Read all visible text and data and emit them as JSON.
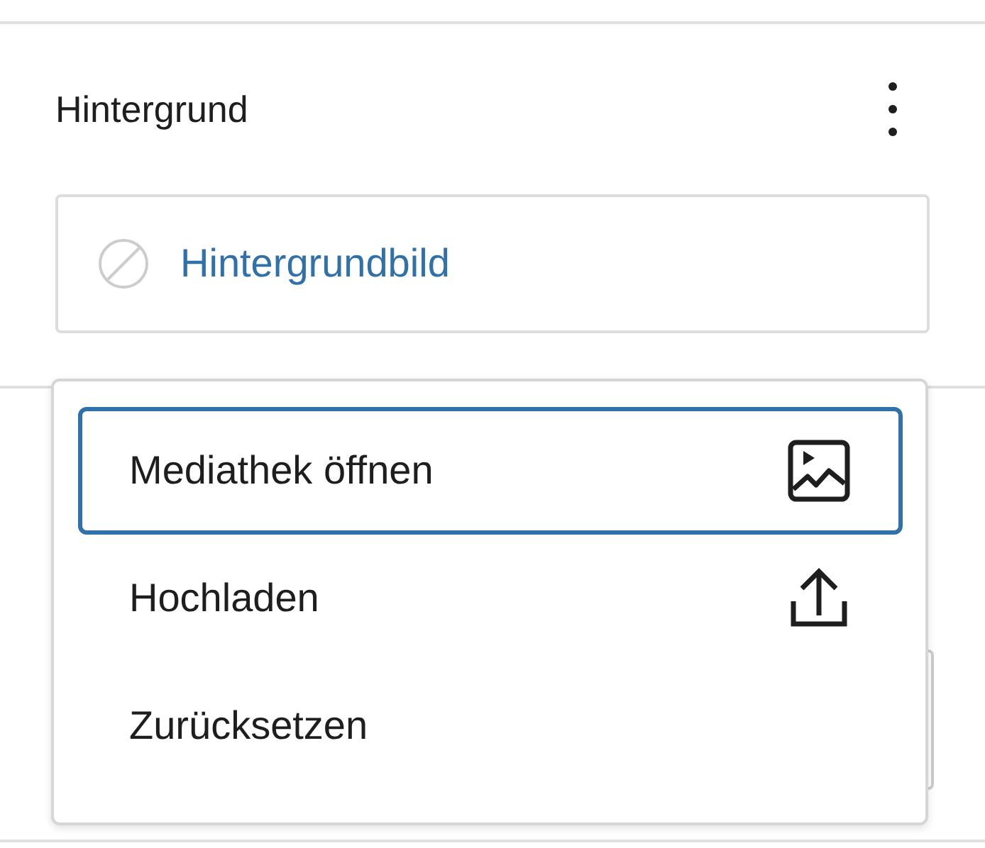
{
  "panel": {
    "title": "Hintergrund"
  },
  "background_image": {
    "label": "Hintergrundbild"
  },
  "menu": {
    "items": [
      {
        "label": "Mediathek öffnen",
        "kind": "media",
        "selected": true
      },
      {
        "label": "Hochladen",
        "kind": "upload",
        "selected": false
      },
      {
        "label": "Zurücksetzen",
        "kind": "reset",
        "selected": false
      }
    ]
  }
}
